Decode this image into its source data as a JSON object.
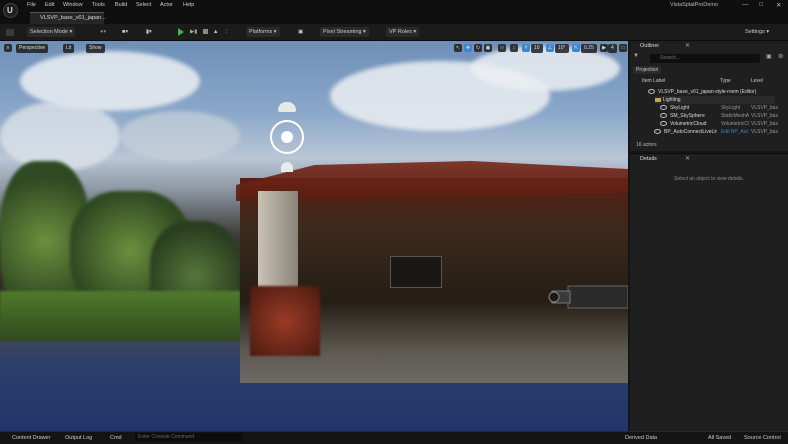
{
  "menu": [
    "File",
    "Edit",
    "Window",
    "Tools",
    "Build",
    "Select",
    "Actor",
    "Help"
  ],
  "project_name": "VistaSplatProDemo",
  "document_tab": "VLSVP_base_v01_japan...",
  "toolbar": {
    "selection_mode": "Selection Mode",
    "platforms": "Platforms",
    "pixel_streaming": "Pixel Streaming",
    "vp_roles": "VP Roles",
    "settings": "Settings"
  },
  "viewport": {
    "perspective": "Perspective",
    "lit": "Lit",
    "show": "Show",
    "grid_snap": "10",
    "rotation_snap": "10°",
    "scale_snap": "0.25",
    "camera_speed": "4"
  },
  "outliner": {
    "tab_label": "Outliner",
    "search_placeholder": "Search...",
    "projection_label": "Projection",
    "columns": {
      "item_label": "Item Label",
      "type": "Type",
      "level": "Level"
    },
    "rows": [
      {
        "label": "VLSVP_base_v01_japan-style-room (Editor)",
        "type": "",
        "level": ""
      },
      {
        "label": "Lighting",
        "type": "",
        "level": ""
      },
      {
        "label": "SkyLight",
        "type": "SkyLight",
        "level": "VLSVP_bas"
      },
      {
        "label": "SM_SkySphere",
        "type": "StaticMeshA",
        "level": "VLSVP_bas"
      },
      {
        "label": "VolumetricCloud",
        "type": "VolumetricCl",
        "level": "VLSVP_bas"
      },
      {
        "label": "BP_AutoConnectLiveLir",
        "type": "Edit BP_Aut",
        "level": "VLSVP_bas"
      }
    ],
    "actor_count": "16 actors"
  },
  "details": {
    "tab_label": "Details",
    "empty_message": "Select an object to view details."
  },
  "statusbar": {
    "content_drawer": "Content Drawer",
    "output_log": "Output Log",
    "cmd": "Cmd",
    "console_placeholder": "Enter Console Command",
    "derived_data": "Derived Data",
    "all_saved": "All Saved",
    "source_control": "Source Control"
  },
  "colors": {
    "play_green": "#3fb34f",
    "accent_blue": "#3a86d4",
    "folder_gold": "#c9a64a"
  }
}
